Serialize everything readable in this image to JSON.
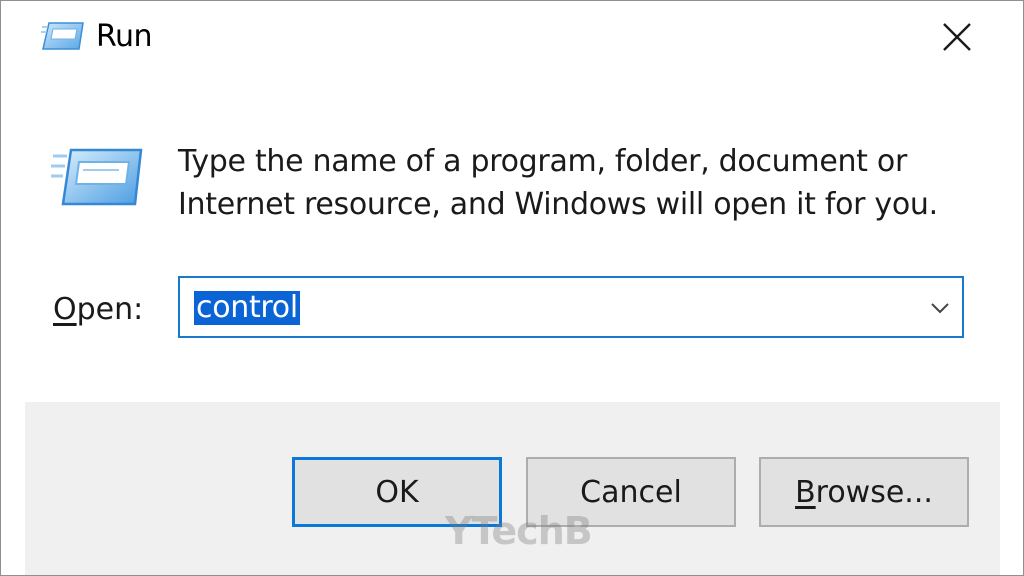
{
  "window": {
    "title": "Run",
    "title_icon": "run-icon",
    "close_icon": "close-icon"
  },
  "content": {
    "icon": "run-icon",
    "description": "Type the name of a program, folder, document or Internet resource, and Windows will open it for you.",
    "open_label_underlined": "O",
    "open_label_rest": "pen:",
    "open_value": "control",
    "dropdown_icon": "chevron-down-icon"
  },
  "buttons": {
    "ok": "OK",
    "cancel": "Cancel",
    "browse_underlined": "B",
    "browse_rest": "rowse..."
  },
  "watermark": "YTechB",
  "colors": {
    "focus_border": "#1a79cc",
    "selection": "#0a64d6",
    "footer_bg": "#f0f0f0",
    "button_bg": "#e1e1e1"
  }
}
